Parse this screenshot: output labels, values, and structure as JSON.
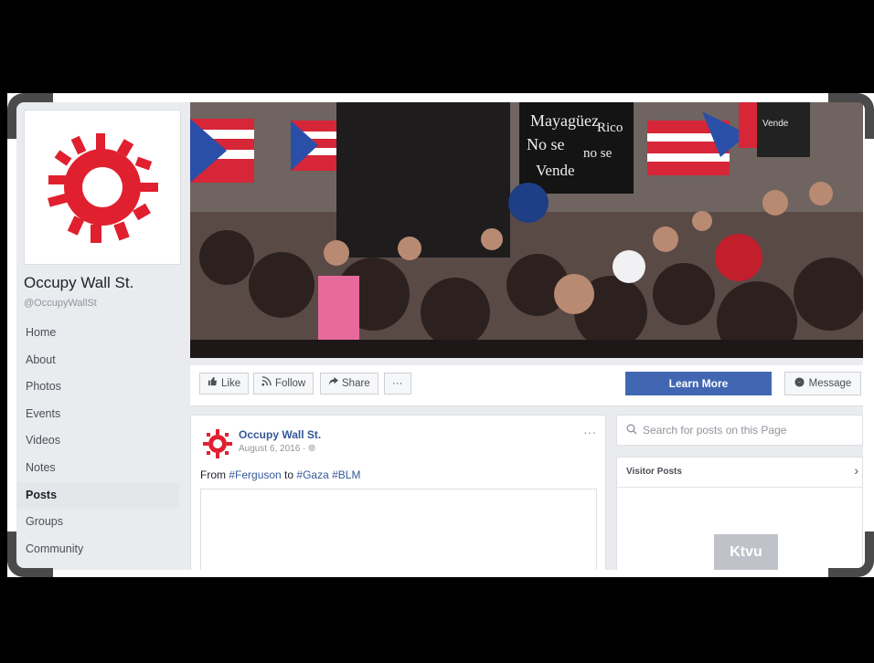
{
  "page": {
    "name": "Occupy Wall St.",
    "handle": "@OccupyWallSt"
  },
  "nav": {
    "items": [
      "Home",
      "About",
      "Photos",
      "Events",
      "Videos",
      "Notes",
      "Posts",
      "Groups",
      "Community"
    ],
    "active": "Posts"
  },
  "cover": {
    "signs": [
      "Mayagüez",
      "Rico",
      "No se",
      "no se",
      "Vende",
      "Vende"
    ]
  },
  "actions": {
    "like": "Like",
    "follow": "Follow",
    "share": "Share",
    "more": "···",
    "learn_more": "Learn More",
    "message": "Message"
  },
  "post": {
    "author": "Occupy Wall St.",
    "date": "August 6, 2016 · ",
    "more": "···",
    "text_prefix": "From ",
    "tag1": "#Ferguson",
    "text_mid": " to ",
    "tag2": "#Gaza",
    "tag3": "#BLM"
  },
  "search": {
    "placeholder": "Search for posts on this Page"
  },
  "visitor_posts": {
    "title": "Visitor Posts",
    "chevron": "›",
    "thumb_text": "Ktvu"
  },
  "colors": {
    "brand_red": "#e0202f",
    "fb_blue": "#4267b2",
    "link_blue": "#365899"
  }
}
